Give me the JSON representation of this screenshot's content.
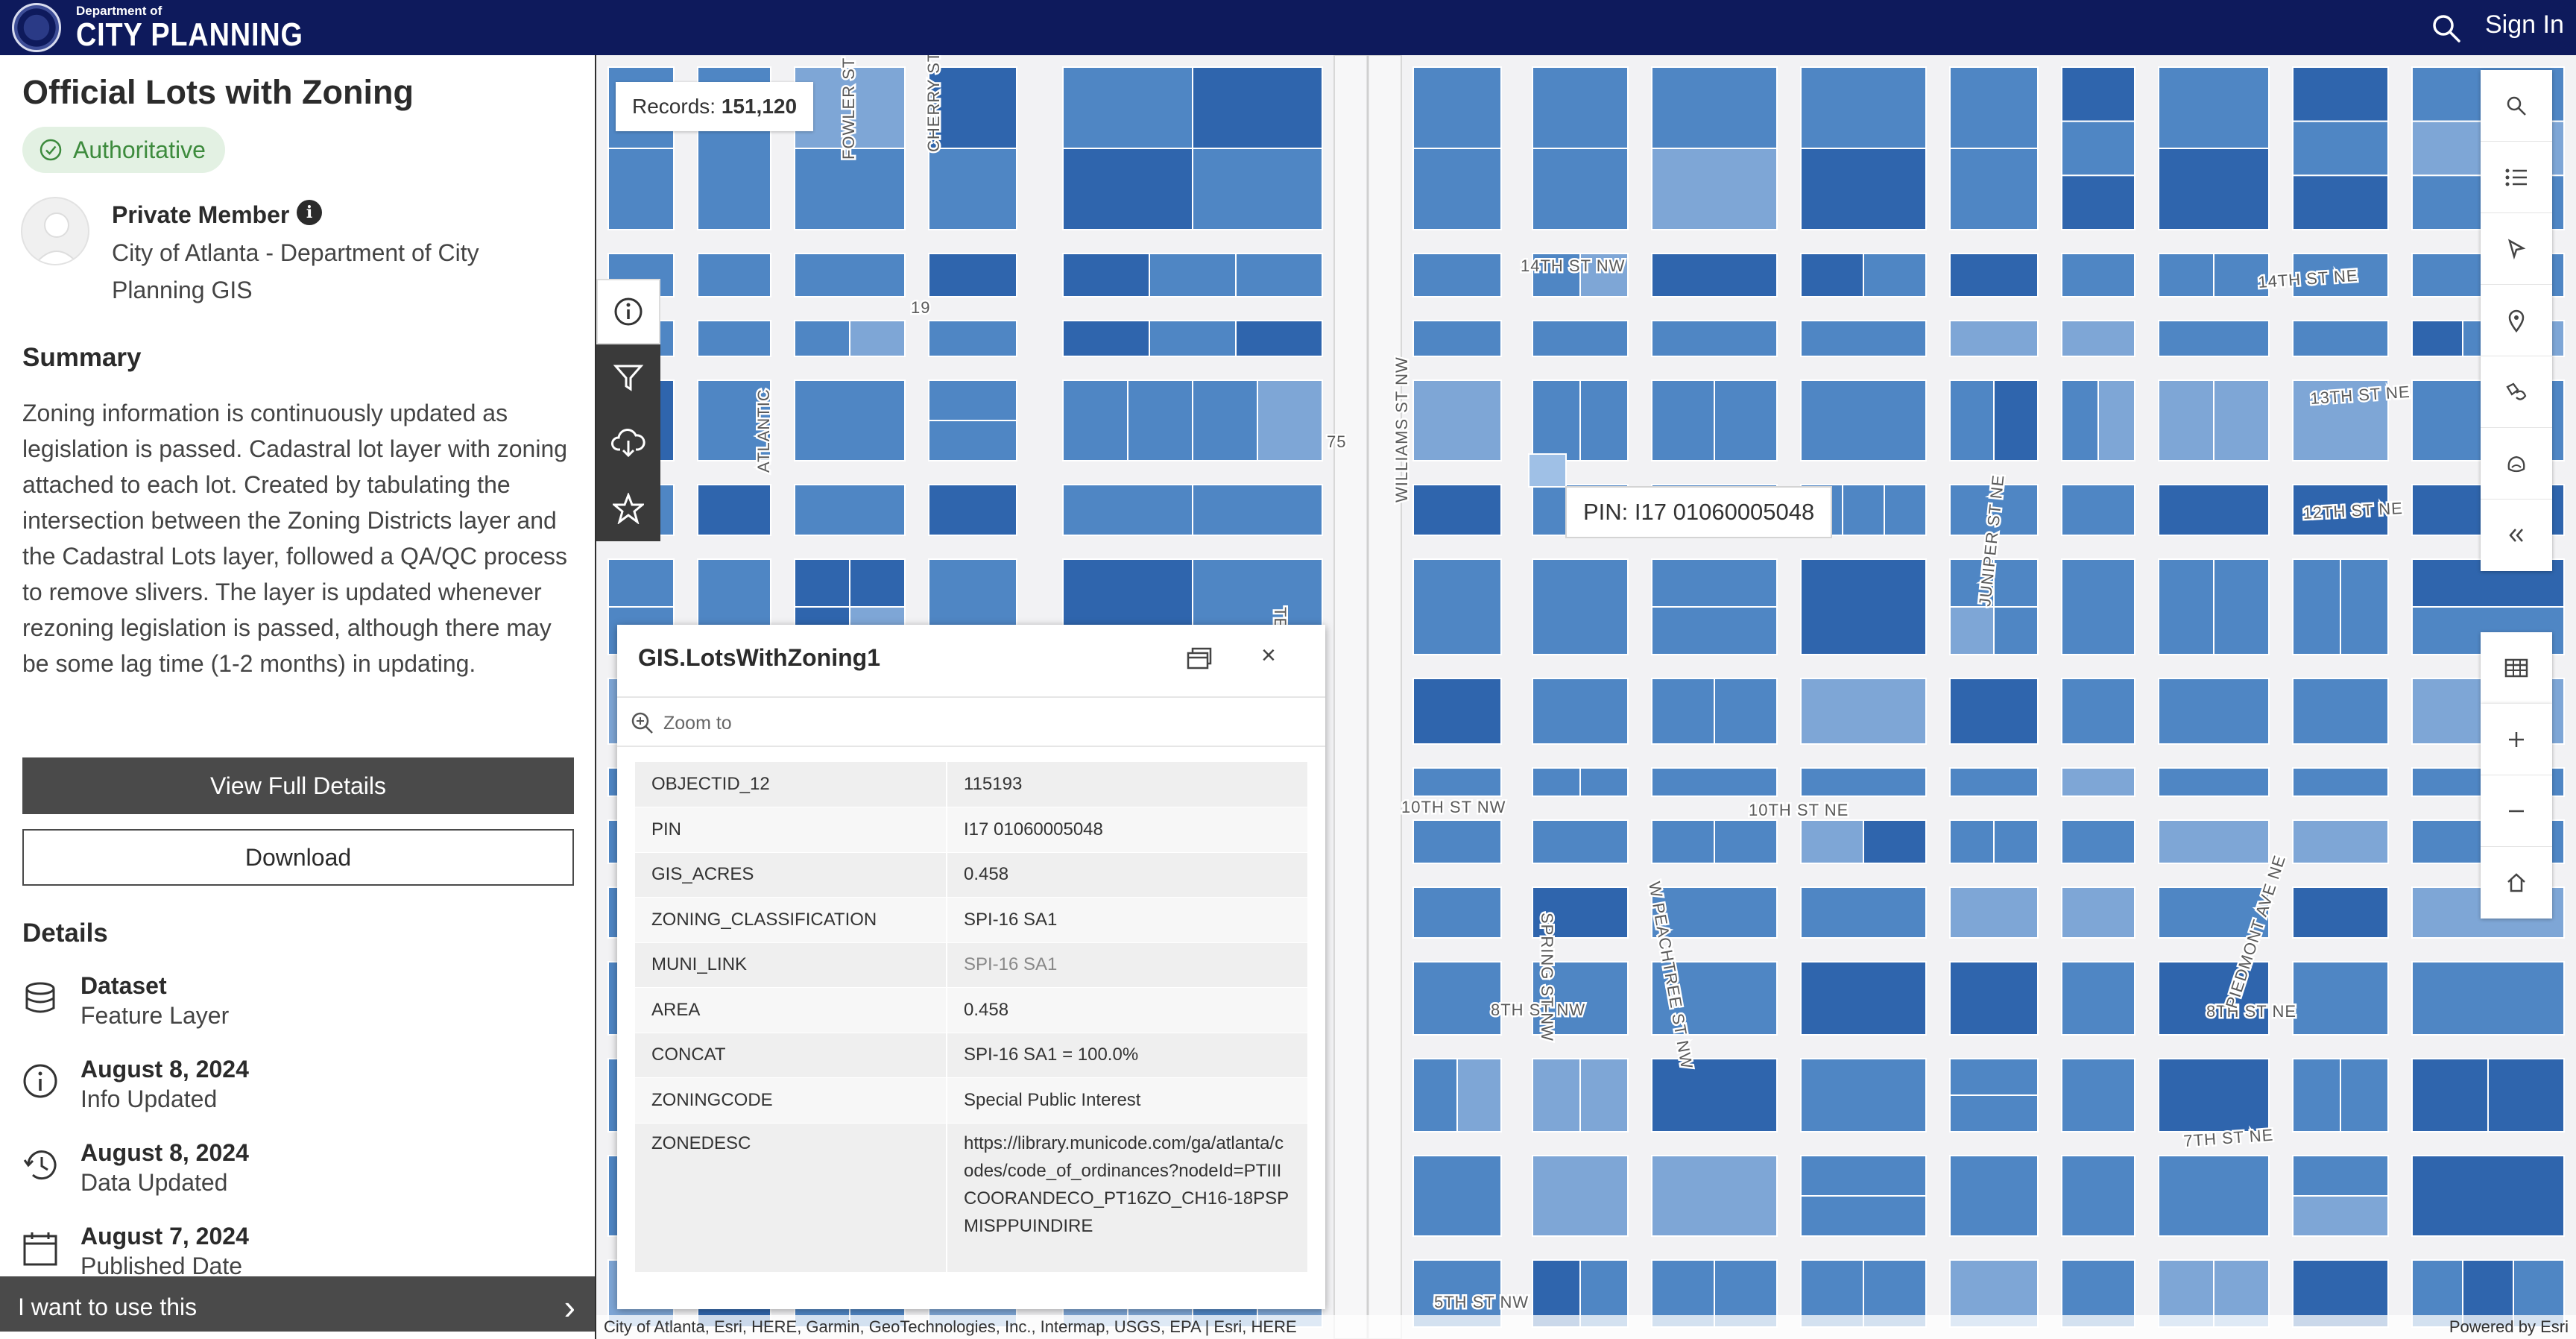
{
  "header": {
    "logo_small": "Department of",
    "logo_big": "CITY PLANNING",
    "signin_label": "Sign In"
  },
  "sidebar": {
    "title": "Official Lots with Zoning",
    "badge": "Authoritative",
    "owner": "Private Member",
    "org": "City of Atlanta - Department of City Planning GIS",
    "summary_heading": "Summary",
    "summary_text": "Zoning information is continuously updated as legislation is passed. Cadastral lot layer with zoning attached to each lot. Created by tabulating the intersection between the Zoning Districts layer and the Cadastral Lots layer, followed a QA/QC process to remove slivers. The layer is updated whenever rezoning legislation is passed, although there may be some lag time (1-2 months) in updating.",
    "view_full_details": "View Full Details",
    "download": "Download",
    "details_heading": "Details",
    "details": [
      {
        "icon": "database-icon",
        "main": "Dataset",
        "sub": "Feature Layer"
      },
      {
        "icon": "info-icon",
        "main": "August 8, 2024",
        "sub": "Info Updated"
      },
      {
        "icon": "history-icon",
        "main": "August 8, 2024",
        "sub": "Data Updated"
      },
      {
        "icon": "calendar-icon",
        "main": "August 7, 2024",
        "sub": "Published Date"
      }
    ],
    "use_bar": "I want to use this"
  },
  "map": {
    "records_label": "Records:",
    "records_count": "151,120",
    "pin_label": "PIN: I17 01060005048",
    "attribution": "City of Atlanta, Esri, HERE, Garmin, GeoTechnologies, Inc., Intermap, USGS, EPA | Esri, HERE",
    "powered_by": "Powered by Esri",
    "street_labels": [
      "14TH ST NW",
      "14TH ST NE",
      "13TH ST NE",
      "12TH ST NE",
      "10TH ST NW",
      "10TH ST NE",
      "8TH ST NW",
      "8TH ST NE",
      "7TH ST NE",
      "5TH ST NW",
      "WILLIAMS ST NW",
      "TECHWOOD",
      "SPRING ST NW",
      "W PEACHTREE ST NW",
      "JUNIPER ST NE",
      "PIEDMONT AVE NE",
      "ATLANTIC",
      "FOWLER ST",
      "CHERRY ST",
      "75",
      "19"
    ],
    "lot_fill": "#4f86c4",
    "lot_fill_dark": "#2f65ad",
    "lot_fill_light": "#7ea6d6",
    "street_color": "#f2f2f4"
  },
  "popup": {
    "title": "GIS.LotsWithZoning1",
    "zoom_to": "Zoom to",
    "rows": [
      {
        "key": "OBJECTID_12",
        "value": "115193"
      },
      {
        "key": "PIN",
        "value": "I17 01060005048"
      },
      {
        "key": "GIS_ACRES",
        "value": "0.458"
      },
      {
        "key": "ZONING_CLASSIFICATION",
        "value": "SPI-16 SA1"
      },
      {
        "key": "MUNI_LINK",
        "value": "SPI-16 SA1"
      },
      {
        "key": "AREA",
        "value": "0.458"
      },
      {
        "key": "CONCAT",
        "value": "SPI-16 SA1 = 100.0%"
      },
      {
        "key": "ZONINGCODE",
        "value": "Special Public Interest"
      },
      {
        "key": "ZONEDESC",
        "value": "https://library.municode.com/ga/atlanta/codes/code_of_ordinances?nodeId=PTIIICOORANDECO_PT16ZO_CH16-18PSPMISPPUINDIRE"
      }
    ]
  }
}
